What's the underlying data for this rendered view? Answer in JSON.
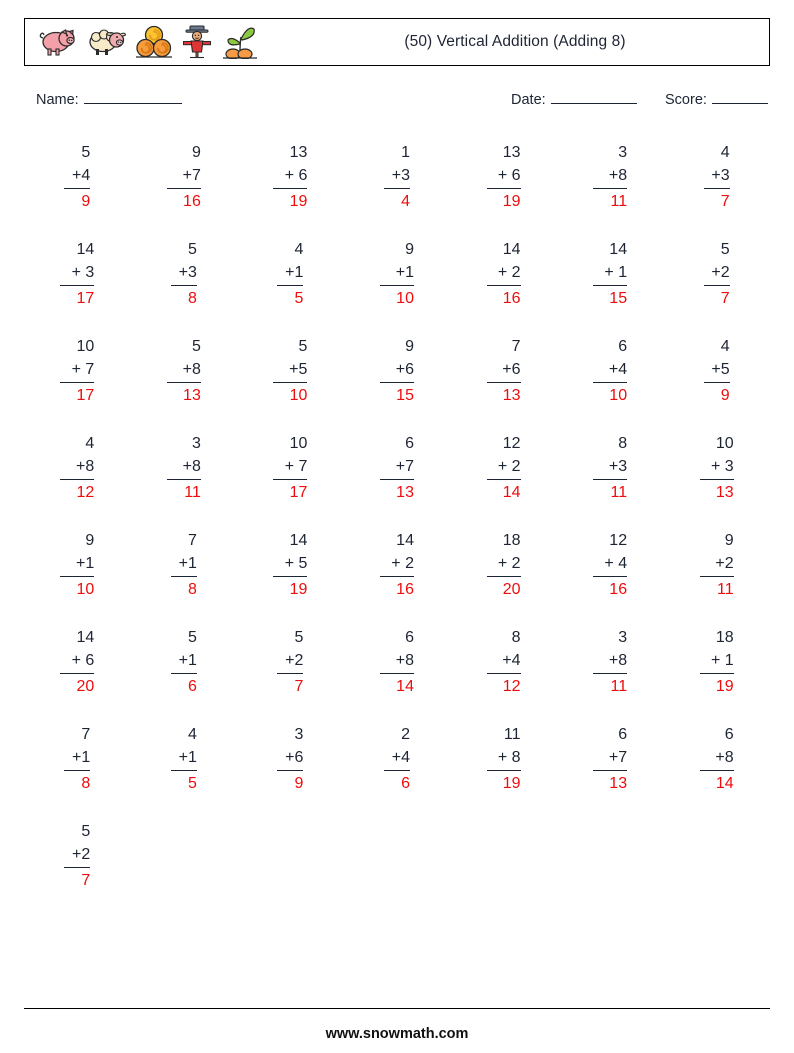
{
  "header": {
    "title": "(50) Vertical Addition (Adding 8)",
    "icons": [
      "pig-icon",
      "sheep-icon",
      "hay-bales-icon",
      "scarecrow-icon",
      "sprout-icon"
    ]
  },
  "meta": {
    "name_label": "Name:",
    "date_label": "Date:",
    "score_label": "Score:"
  },
  "colors": {
    "text": "#1d2433",
    "answer": "#ee0c0c",
    "border": "#000000"
  },
  "operator": "+",
  "rows": [
    [
      {
        "top": "5",
        "op": "+",
        "bottom": "4",
        "answer": "9"
      },
      {
        "top": "9",
        "op": "+",
        "bottom": "7",
        "answer": "16"
      },
      {
        "top": "13",
        "op": "+",
        "bottom": "6",
        "answer": "19"
      },
      {
        "top": "1",
        "op": "+",
        "bottom": "3",
        "answer": "4"
      },
      {
        "top": "13",
        "op": "+",
        "bottom": "6",
        "answer": "19"
      },
      {
        "top": "3",
        "op": "+",
        "bottom": "8",
        "answer": "11"
      },
      {
        "top": "4",
        "op": "+",
        "bottom": "3",
        "answer": "7"
      }
    ],
    [
      {
        "top": "14",
        "op": "+",
        "bottom": "3",
        "answer": "17"
      },
      {
        "top": "5",
        "op": "+",
        "bottom": "3",
        "answer": "8"
      },
      {
        "top": "4",
        "op": "+",
        "bottom": "1",
        "answer": "5"
      },
      {
        "top": "9",
        "op": "+",
        "bottom": "1",
        "answer": "10"
      },
      {
        "top": "14",
        "op": "+",
        "bottom": "2",
        "answer": "16"
      },
      {
        "top": "14",
        "op": "+",
        "bottom": "1",
        "answer": "15"
      },
      {
        "top": "5",
        "op": "+",
        "bottom": "2",
        "answer": "7"
      }
    ],
    [
      {
        "top": "10",
        "op": "+",
        "bottom": "7",
        "answer": "17"
      },
      {
        "top": "5",
        "op": "+",
        "bottom": "8",
        "answer": "13"
      },
      {
        "top": "5",
        "op": "+",
        "bottom": "5",
        "answer": "10"
      },
      {
        "top": "9",
        "op": "+",
        "bottom": "6",
        "answer": "15"
      },
      {
        "top": "7",
        "op": "+",
        "bottom": "6",
        "answer": "13"
      },
      {
        "top": "6",
        "op": "+",
        "bottom": "4",
        "answer": "10"
      },
      {
        "top": "4",
        "op": "+",
        "bottom": "5",
        "answer": "9"
      }
    ],
    [
      {
        "top": "4",
        "op": "+",
        "bottom": "8",
        "answer": "12"
      },
      {
        "top": "3",
        "op": "+",
        "bottom": "8",
        "answer": "11"
      },
      {
        "top": "10",
        "op": "+",
        "bottom": "7",
        "answer": "17"
      },
      {
        "top": "6",
        "op": "+",
        "bottom": "7",
        "answer": "13"
      },
      {
        "top": "12",
        "op": "+",
        "bottom": "2",
        "answer": "14"
      },
      {
        "top": "8",
        "op": "+",
        "bottom": "3",
        "answer": "11"
      },
      {
        "top": "10",
        "op": "+",
        "bottom": "3",
        "answer": "13"
      }
    ],
    [
      {
        "top": "9",
        "op": "+",
        "bottom": "1",
        "answer": "10"
      },
      {
        "top": "7",
        "op": "+",
        "bottom": "1",
        "answer": "8"
      },
      {
        "top": "14",
        "op": "+",
        "bottom": "5",
        "answer": "19"
      },
      {
        "top": "14",
        "op": "+",
        "bottom": "2",
        "answer": "16"
      },
      {
        "top": "18",
        "op": "+",
        "bottom": "2",
        "answer": "20"
      },
      {
        "top": "12",
        "op": "+",
        "bottom": "4",
        "answer": "16"
      },
      {
        "top": "9",
        "op": "+",
        "bottom": "2",
        "answer": "11"
      }
    ],
    [
      {
        "top": "14",
        "op": "+",
        "bottom": "6",
        "answer": "20"
      },
      {
        "top": "5",
        "op": "+",
        "bottom": "1",
        "answer": "6"
      },
      {
        "top": "5",
        "op": "+",
        "bottom": "2",
        "answer": "7"
      },
      {
        "top": "6",
        "op": "+",
        "bottom": "8",
        "answer": "14"
      },
      {
        "top": "8",
        "op": "+",
        "bottom": "4",
        "answer": "12"
      },
      {
        "top": "3",
        "op": "+",
        "bottom": "8",
        "answer": "11"
      },
      {
        "top": "18",
        "op": "+",
        "bottom": "1",
        "answer": "19"
      }
    ],
    [
      {
        "top": "7",
        "op": "+",
        "bottom": "1",
        "answer": "8"
      },
      {
        "top": "4",
        "op": "+",
        "bottom": "1",
        "answer": "5"
      },
      {
        "top": "3",
        "op": "+",
        "bottom": "6",
        "answer": "9"
      },
      {
        "top": "2",
        "op": "+",
        "bottom": "4",
        "answer": "6"
      },
      {
        "top": "11",
        "op": "+",
        "bottom": "8",
        "answer": "19"
      },
      {
        "top": "6",
        "op": "+",
        "bottom": "7",
        "answer": "13"
      },
      {
        "top": "6",
        "op": "+",
        "bottom": "8",
        "answer": "14"
      }
    ],
    [
      {
        "top": "5",
        "op": "+",
        "bottom": "2",
        "answer": "7"
      }
    ]
  ],
  "footer": {
    "site": "www.snowmath.com"
  }
}
